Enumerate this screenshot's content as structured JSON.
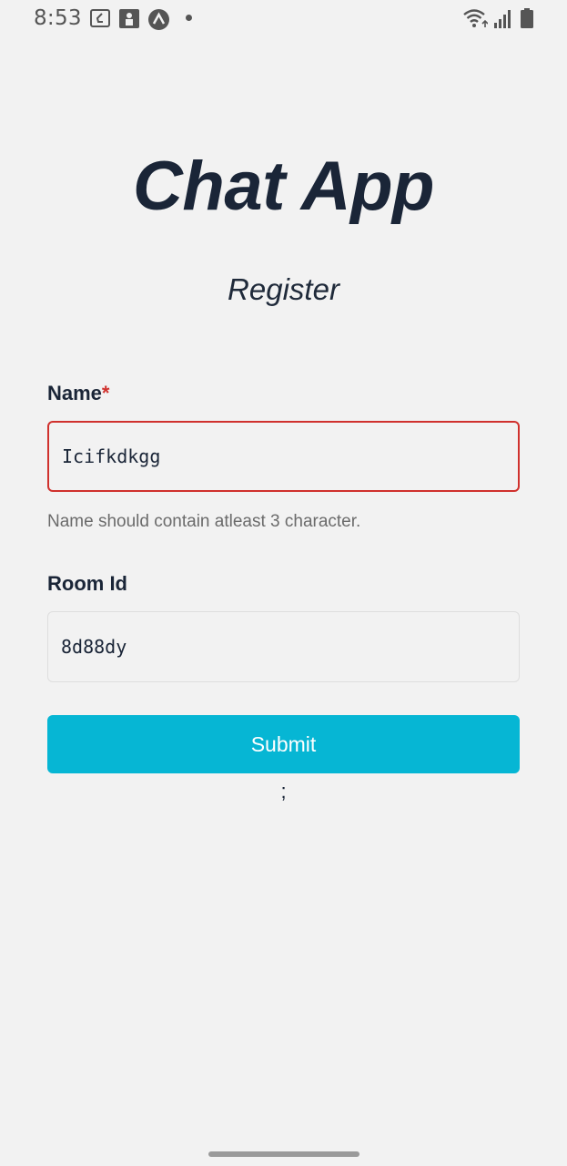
{
  "status_bar": {
    "time": "8:53",
    "icons": [
      "notification-app-icon",
      "notification-lock-icon",
      "notification-a-icon",
      "wifi-icon",
      "signal-icon",
      "battery-icon"
    ]
  },
  "header": {
    "title": "Chat App",
    "subtitle": "Register"
  },
  "form": {
    "name_label": "Name",
    "required_mark": "*",
    "name_value": "Icifkdkgg",
    "name_error": "Name should contain atleast 3 character.",
    "room_label": "Room Id",
    "room_value": "8d88dy",
    "submit_label": "Submit",
    "trailing_text": ";"
  },
  "colors": {
    "accent": "#06b6d4",
    "error": "#d0312d",
    "background": "#f2f2f2",
    "text": "#1a2537"
  }
}
